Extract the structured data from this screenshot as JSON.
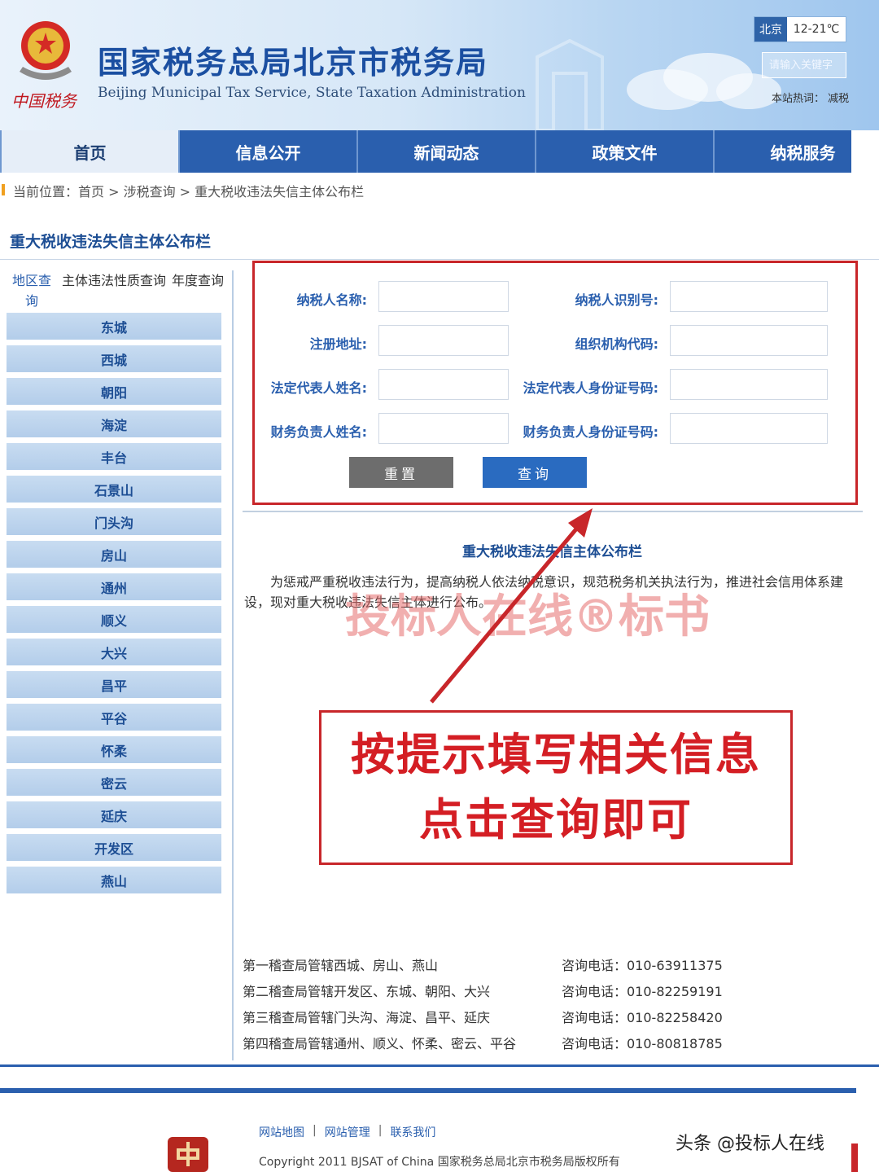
{
  "header": {
    "title": "国家税务总局北京市税务局",
    "subtitle": "Beijing Municipal Tax Service, State Taxation Administration",
    "brand": "中国税务",
    "weather_city": "北京",
    "weather_temp": "12-21℃",
    "search_placeholder": "请输入关键字",
    "hot_words": "本站热词：  减税"
  },
  "nav": {
    "items": [
      "首页",
      "信息公开",
      "新闻动态",
      "政策文件",
      "纳税服务"
    ],
    "active": "首页"
  },
  "breadcrumb": "当前位置：首页 > 涉税查询 > 重大税收违法失信主体公布栏",
  "section_title": "重大税收违法失信主体公布栏",
  "left_tabs": [
    "地区查询",
    "主体违法性质查询",
    "年度查询"
  ],
  "districts": [
    "东城",
    "西城",
    "朝阳",
    "海淀",
    "丰台",
    "石景山",
    "门头沟",
    "房山",
    "通州",
    "顺义",
    "大兴",
    "昌平",
    "平谷",
    "怀柔",
    "密云",
    "延庆",
    "开发区",
    "燕山"
  ],
  "form": {
    "taxpayer_name": "纳税人名称:",
    "taxpayer_id": "纳税人识别号:",
    "reg_address": "注册地址:",
    "org_code": "组织机构代码:",
    "legal_rep_name": "法定代表人姓名:",
    "legal_rep_id": "法定代表人身份证号码:",
    "finance_name": "财务负责人姓名:",
    "finance_id": "财务负责人身份证号码:",
    "reset_label": "重置",
    "query_label": "查询"
  },
  "content": {
    "title": "重大税收违法失信主体公布栏",
    "text": "为惩戒严重税收违法行为，提高纳税人依法纳税意识，规范税务机关执法行为，推进社会信用体系建设，现对重大税收违法失信主体进行公布。"
  },
  "watermark": "投标人在线®标书",
  "annotation": {
    "line1": "按提示填写相关信息",
    "line2": "点击查询即可"
  },
  "offices": [
    {
      "name": "第一稽查局管辖西城、房山、燕山",
      "phone": "咨询电话：010-63911375"
    },
    {
      "name": "第二稽查局管辖开发区、东城、朝阳、大兴",
      "phone": "咨询电话：010-82259191"
    },
    {
      "name": "第三稽查局管辖门头沟、海淀、昌平、延庆",
      "phone": "咨询电话：010-82258420"
    },
    {
      "name": "第四稽查局管辖通州、顺义、怀柔、密云、平谷",
      "phone": "咨询电话：010-80818785"
    }
  ],
  "footer": {
    "links": [
      "网站地图",
      "网站管理",
      "联系我们"
    ],
    "copyright": "Copyright 2011 BJSAT of China 国家税务总局北京市税务局版权所有",
    "toutiao": "头条 @投标人在线"
  },
  "colors": {
    "nav_blue": "#2a5fae",
    "annotation_red": "#d41e24",
    "title_blue": "#1b4fa1"
  }
}
